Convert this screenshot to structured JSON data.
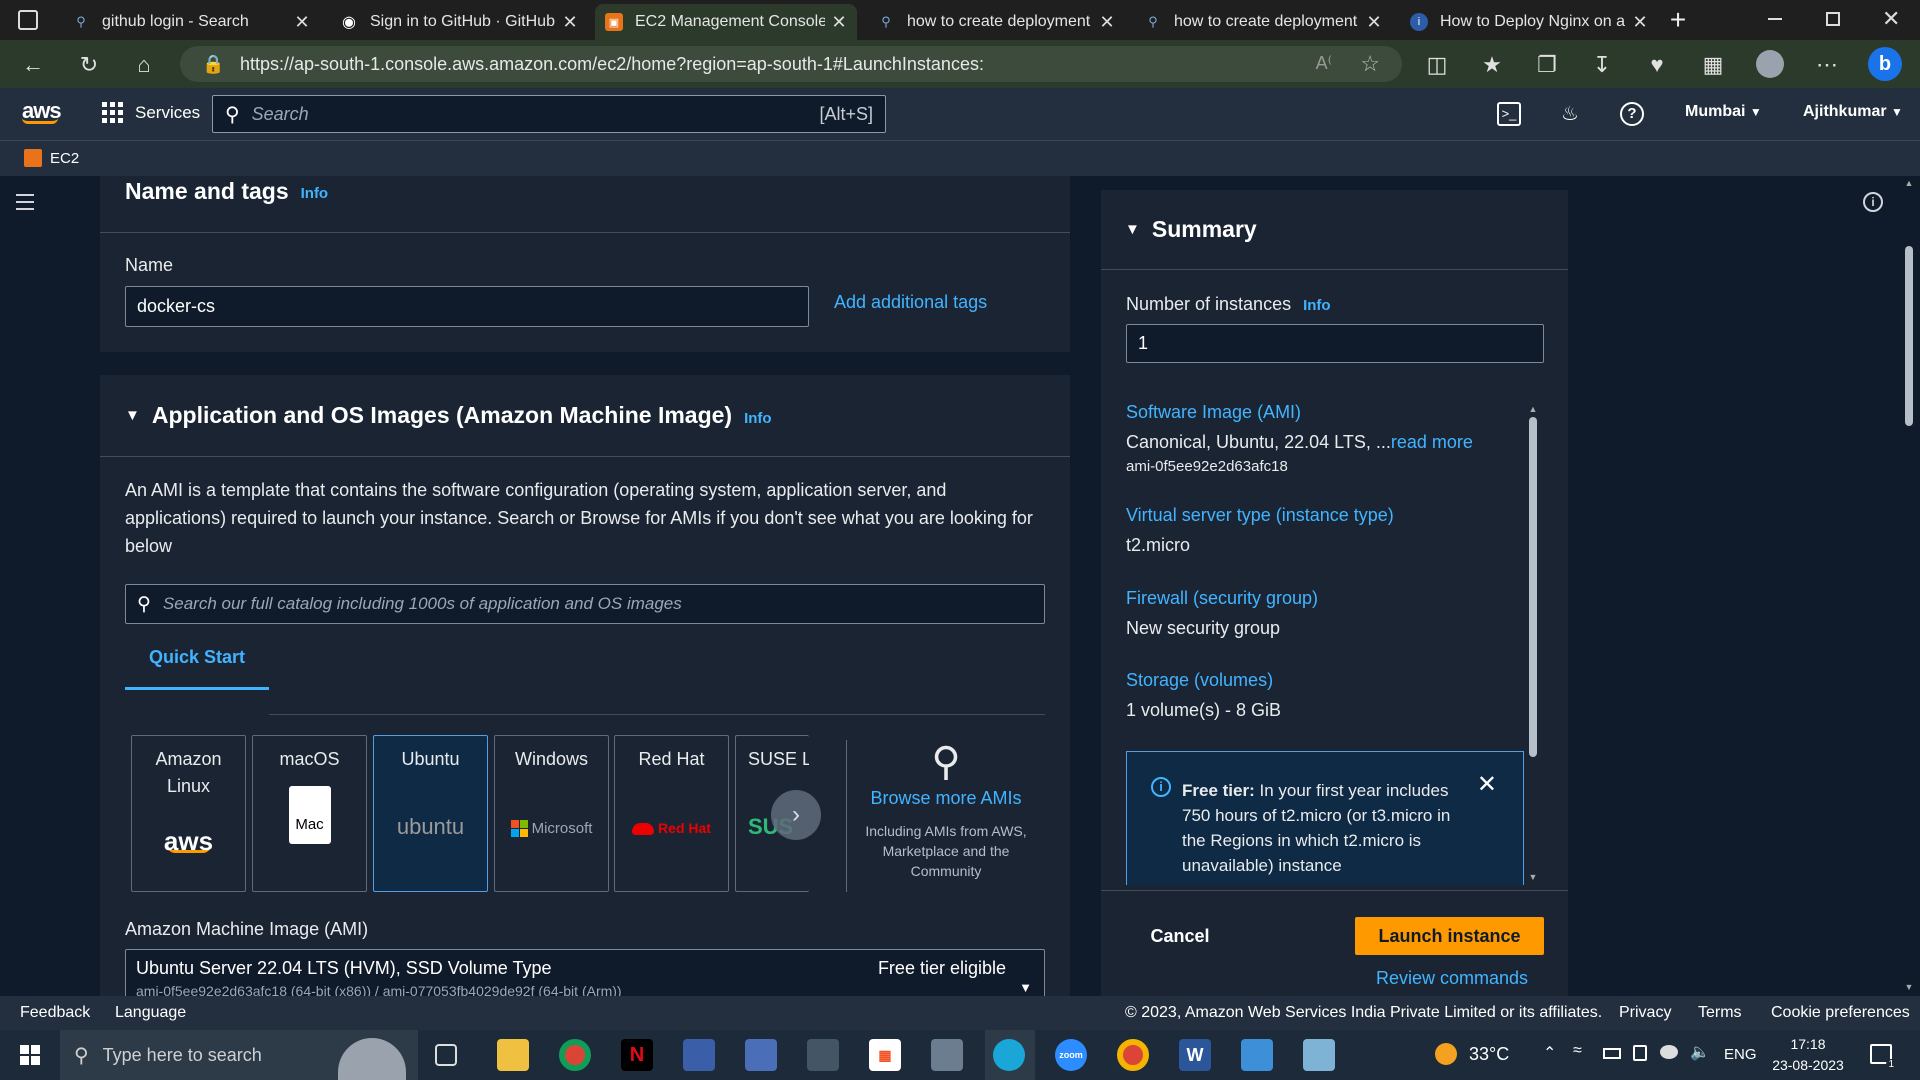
{
  "browser": {
    "tabs": [
      {
        "title": "github login - Search",
        "icon": "search-icon",
        "active": false
      },
      {
        "title": "Sign in to GitHub · GitHub",
        "icon": "github-icon",
        "active": false
      },
      {
        "title": "EC2 Management Console",
        "icon": "aws-icon",
        "active": true
      },
      {
        "title": "how to create deployment f",
        "icon": "search-icon",
        "active": false
      },
      {
        "title": "how to create deployment f",
        "icon": "search-icon",
        "active": false
      },
      {
        "title": "How to Deploy Nginx on a I",
        "icon": "site-icon",
        "active": false
      }
    ],
    "new_tab": "+",
    "url": "https://ap-south-1.console.aws.amazon.com/ec2/home?region=ap-south-1#LaunchInstances:"
  },
  "aws_header": {
    "logo": "aws",
    "services": "Services",
    "search_placeholder": "Search",
    "search_shortcut": "[Alt+S]",
    "region": "Mumbai",
    "user": "Ajithkumar",
    "service_crumb": "EC2"
  },
  "name_tags": {
    "title": "Name and tags",
    "info": "Info",
    "name_label": "Name",
    "name_value": "docker-cs",
    "add_tags": "Add additional tags"
  },
  "ami_section": {
    "title": "Application and OS Images (Amazon Machine Image)",
    "info": "Info",
    "description": "An AMI is a template that contains the software configuration (operating system, application server, and applications) required to launch your instance. Search or Browse for AMIs if you don't see what you are looking for below",
    "search_placeholder": "Search our full catalog including 1000s of application and OS images",
    "tab_quick_start": "Quick Start",
    "tiles": [
      {
        "name": "Amazon Linux",
        "logo": "aws"
      },
      {
        "name": "macOS",
        "logo": "Mac"
      },
      {
        "name": "Ubuntu",
        "logo": "ubuntu"
      },
      {
        "name": "Windows",
        "logo": "Microsoft"
      },
      {
        "name": "Red Hat",
        "logo": "Red Hat"
      },
      {
        "name": "SUSE Li",
        "logo": "SUS"
      }
    ],
    "browse_more": "Browse more AMIs",
    "browse_sub": "Including AMIs from AWS, Marketplace and the Community",
    "ami_label": "Amazon Machine Image (AMI)",
    "ami_value": "Ubuntu Server 22.04 LTS (HVM), SSD Volume Type",
    "ami_ids": "ami-0f5ee92e2d63afc18 (64-bit (x86)) / ami-077053fb4029de92f (64-bit (Arm))",
    "free_tier_badge": "Free tier eligible"
  },
  "summary": {
    "title": "Summary",
    "instances_label": "Number of instances",
    "info": "Info",
    "instances_value": "1",
    "software_image_label": "Software Image (AMI)",
    "software_image_value": "Canonical, Ubuntu, 22.04 LTS, ...",
    "read_more": "read more",
    "ami_id": "ami-0f5ee92e2d63afc18",
    "instance_type_label": "Virtual server type (instance type)",
    "instance_type_value": "t2.micro",
    "firewall_label": "Firewall (security group)",
    "firewall_value": "New security group",
    "storage_label": "Storage (volumes)",
    "storage_value": "1 volume(s) - 8 GiB",
    "free_tier_title": "Free tier:",
    "free_tier_text": "In your first year includes 750 hours of t2.micro (or t3.micro in the Regions in which t2.micro is unavailable) instance",
    "cancel": "Cancel",
    "launch": "Launch instance",
    "review": "Review commands"
  },
  "footer": {
    "feedback": "Feedback",
    "language": "Language",
    "copyright": "© 2023, Amazon Web Services India Private Limited or its affiliates.",
    "privacy": "Privacy",
    "terms": "Terms",
    "cookies": "Cookie preferences"
  },
  "taskbar": {
    "search_placeholder": "Type here to search",
    "weather": "33°C",
    "lang": "ENG",
    "time": "17:18",
    "date": "23-08-2023",
    "notifications": "1"
  },
  "colors": {
    "accent_orange": "#ff9900",
    "link_blue": "#42b4ff",
    "panel": "#1b2433",
    "background": "#0f1b2a"
  }
}
